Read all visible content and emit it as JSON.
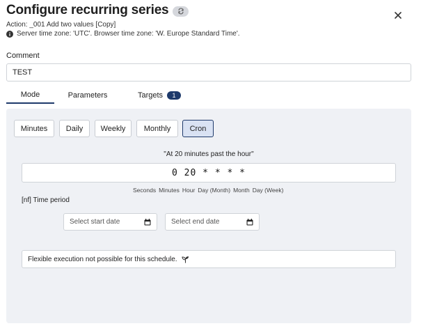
{
  "dialog": {
    "title": "Configure recurring series",
    "recur_icon": "recurring-arrows-icon",
    "close_icon": "close-icon"
  },
  "info": {
    "action": "Action: _001 Add two values [Copy]",
    "timezone": "Server time zone: 'UTC'. Browser time zone: 'W. Europe Standard Time'.",
    "icon": "info-icon"
  },
  "comment": {
    "label": "Comment",
    "value": "TEST"
  },
  "tabs": {
    "mode": "Mode",
    "parameters": "Parameters",
    "targets": "Targets",
    "targets_count": "1",
    "active": "Mode"
  },
  "modes": {
    "minutes": "Minutes",
    "daily": "Daily",
    "weekly": "Weekly",
    "monthly": "Monthly",
    "cron": "Cron",
    "selected": "Cron"
  },
  "cron": {
    "description": "\"At 20 minutes past the hour\"",
    "expression": "0 20 * * * *",
    "fields": [
      "Seconds",
      "Minutes",
      "Hour",
      "Day (Month)",
      "Month",
      "Day (Week)"
    ]
  },
  "time_period": {
    "label": "[nf] Time period",
    "start_placeholder": "Select start date",
    "end_placeholder": "Select end date",
    "icon": "calendar-icon"
  },
  "flexible": {
    "text": "Flexible execution not possible for this schedule.",
    "icon": "sprout-icon"
  },
  "colors": {
    "accent": "#1e3a6b",
    "active_fill": "#d9e2f3",
    "panel_bg": "#eff1f5"
  }
}
